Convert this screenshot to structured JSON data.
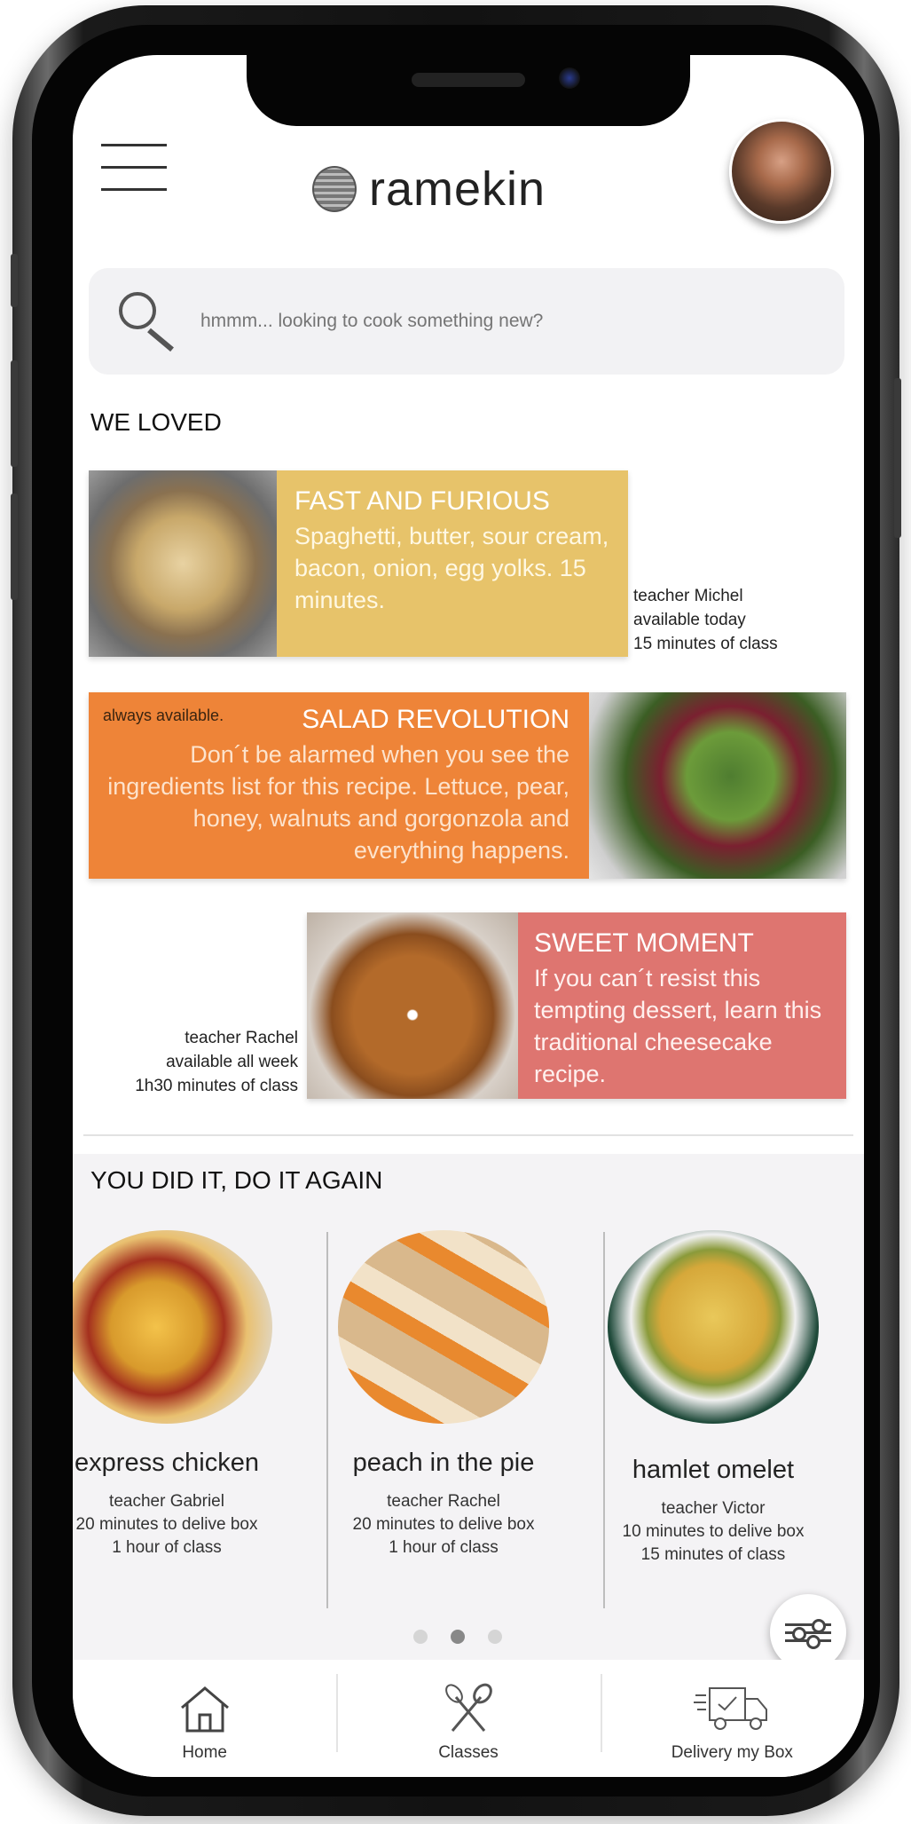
{
  "app": {
    "logo_text": "ramekin"
  },
  "search": {
    "placeholder": "hmmm... looking to cook something new?"
  },
  "sections": {
    "we_loved": "WE LOVED",
    "again": "YOU DID IT, DO IT AGAIN"
  },
  "featured": [
    {
      "title": "FAST AND FURIOUS",
      "description": "Spaghetti, butter, sour cream, bacon, onion, egg yolks. 15 minutes.",
      "teacher": "teacher Michel",
      "availability": "available today",
      "duration": "15 minutes of class",
      "color": "#e7c36a"
    },
    {
      "title": "SALAD REVOLUTION",
      "description": "Don´t be alarmed when you see the ingredients list for this recipe. Lettuce, pear, honey, walnuts and gorgonzola and everything happens.",
      "availability": "always available.",
      "color": "#ee8438"
    },
    {
      "title": "SWEET MOMENT",
      "description": "If you can´t resist this tempting dessert, learn this traditional cheesecake recipe.",
      "teacher": "teacher Rachel",
      "availability": "available all week",
      "duration": "1h30 minutes of class",
      "color": "#de7570"
    }
  ],
  "recent": [
    {
      "name": "express chicken",
      "teacher": "teacher Gabriel",
      "delivery": "20 minutes to delive box",
      "duration": "1 hour of class"
    },
    {
      "name": "peach in the pie",
      "teacher": "teacher Rachel",
      "delivery": "20 minutes to delive box",
      "duration": "1 hour of class"
    },
    {
      "name": "hamlet omelet",
      "teacher": "teacher Victor",
      "delivery": "10 minutes to delive box",
      "duration": "15 minutes of class"
    }
  ],
  "carousel": {
    "active_page": 2,
    "total_pages": 3
  },
  "tabs": [
    {
      "label": "Home",
      "icon": "home-icon"
    },
    {
      "label": "Classes",
      "icon": "whisk-spoon-icon"
    },
    {
      "label": "Delivery my Box",
      "icon": "delivery-truck-icon"
    }
  ]
}
